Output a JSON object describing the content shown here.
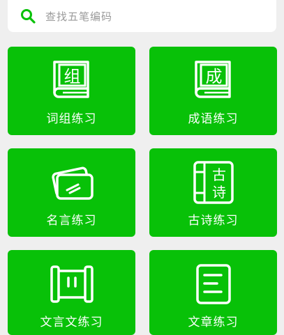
{
  "search": {
    "placeholder": "查找五笔编码"
  },
  "colors": {
    "accent": "#08c108",
    "background": "#efefef"
  },
  "cards": [
    {
      "label": "词组练习",
      "icon": "book-icon",
      "glyph": "组"
    },
    {
      "label": "成语练习",
      "icon": "book-icon",
      "glyph": "成"
    },
    {
      "label": "名言练习",
      "icon": "cards-icon"
    },
    {
      "label": "古诗练习",
      "icon": "poem-icon",
      "glyph_top": "古",
      "glyph_bottom": "诗"
    },
    {
      "label": "文言文练习",
      "icon": "scroll-icon"
    },
    {
      "label": "文章练习",
      "icon": "document-icon"
    }
  ]
}
